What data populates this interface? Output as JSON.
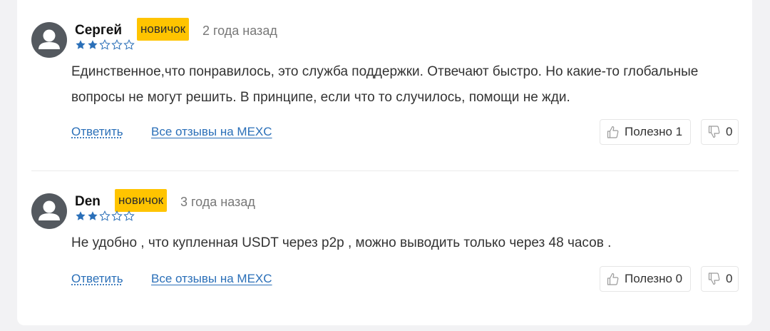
{
  "reviews": [
    {
      "author": "Сергей",
      "badge": "новичок",
      "date": "2 года назад",
      "rating": 2,
      "rating_max": 5,
      "lines": [
        "Единственное,что понравилось, это служба поддержки. Отвечают быстро. Но какие-то глобальные",
        "вопросы не могут решить. В принципе, если что то случилось, помощи не жди."
      ],
      "reply_label": "Ответить",
      "all_reviews_label": "Все отзывы на MEXC",
      "helpful_label": "Полезно 1",
      "dislike_count": "0"
    },
    {
      "author": "Den",
      "badge": "новичок",
      "date": "3 года назад",
      "rating": 2,
      "rating_max": 5,
      "lines": [
        "Не удобно , что купленная USDT через p2p , можно выводить только через 48 часов ."
      ],
      "reply_label": "Ответить",
      "all_reviews_label": "Все отзывы на MEXC",
      "helpful_label": "Полезно 0",
      "dislike_count": "0"
    }
  ],
  "colors": {
    "badge": "#ffc400",
    "star": "#2a6fb8",
    "link": "#2a6fb8",
    "avatar": "#54595f"
  },
  "icons": {
    "avatar": "user-silhouette-icon",
    "star_filled": "star-filled-icon",
    "star_empty": "star-outline-icon",
    "like": "thumbs-up-icon",
    "dislike": "thumbs-down-icon"
  }
}
